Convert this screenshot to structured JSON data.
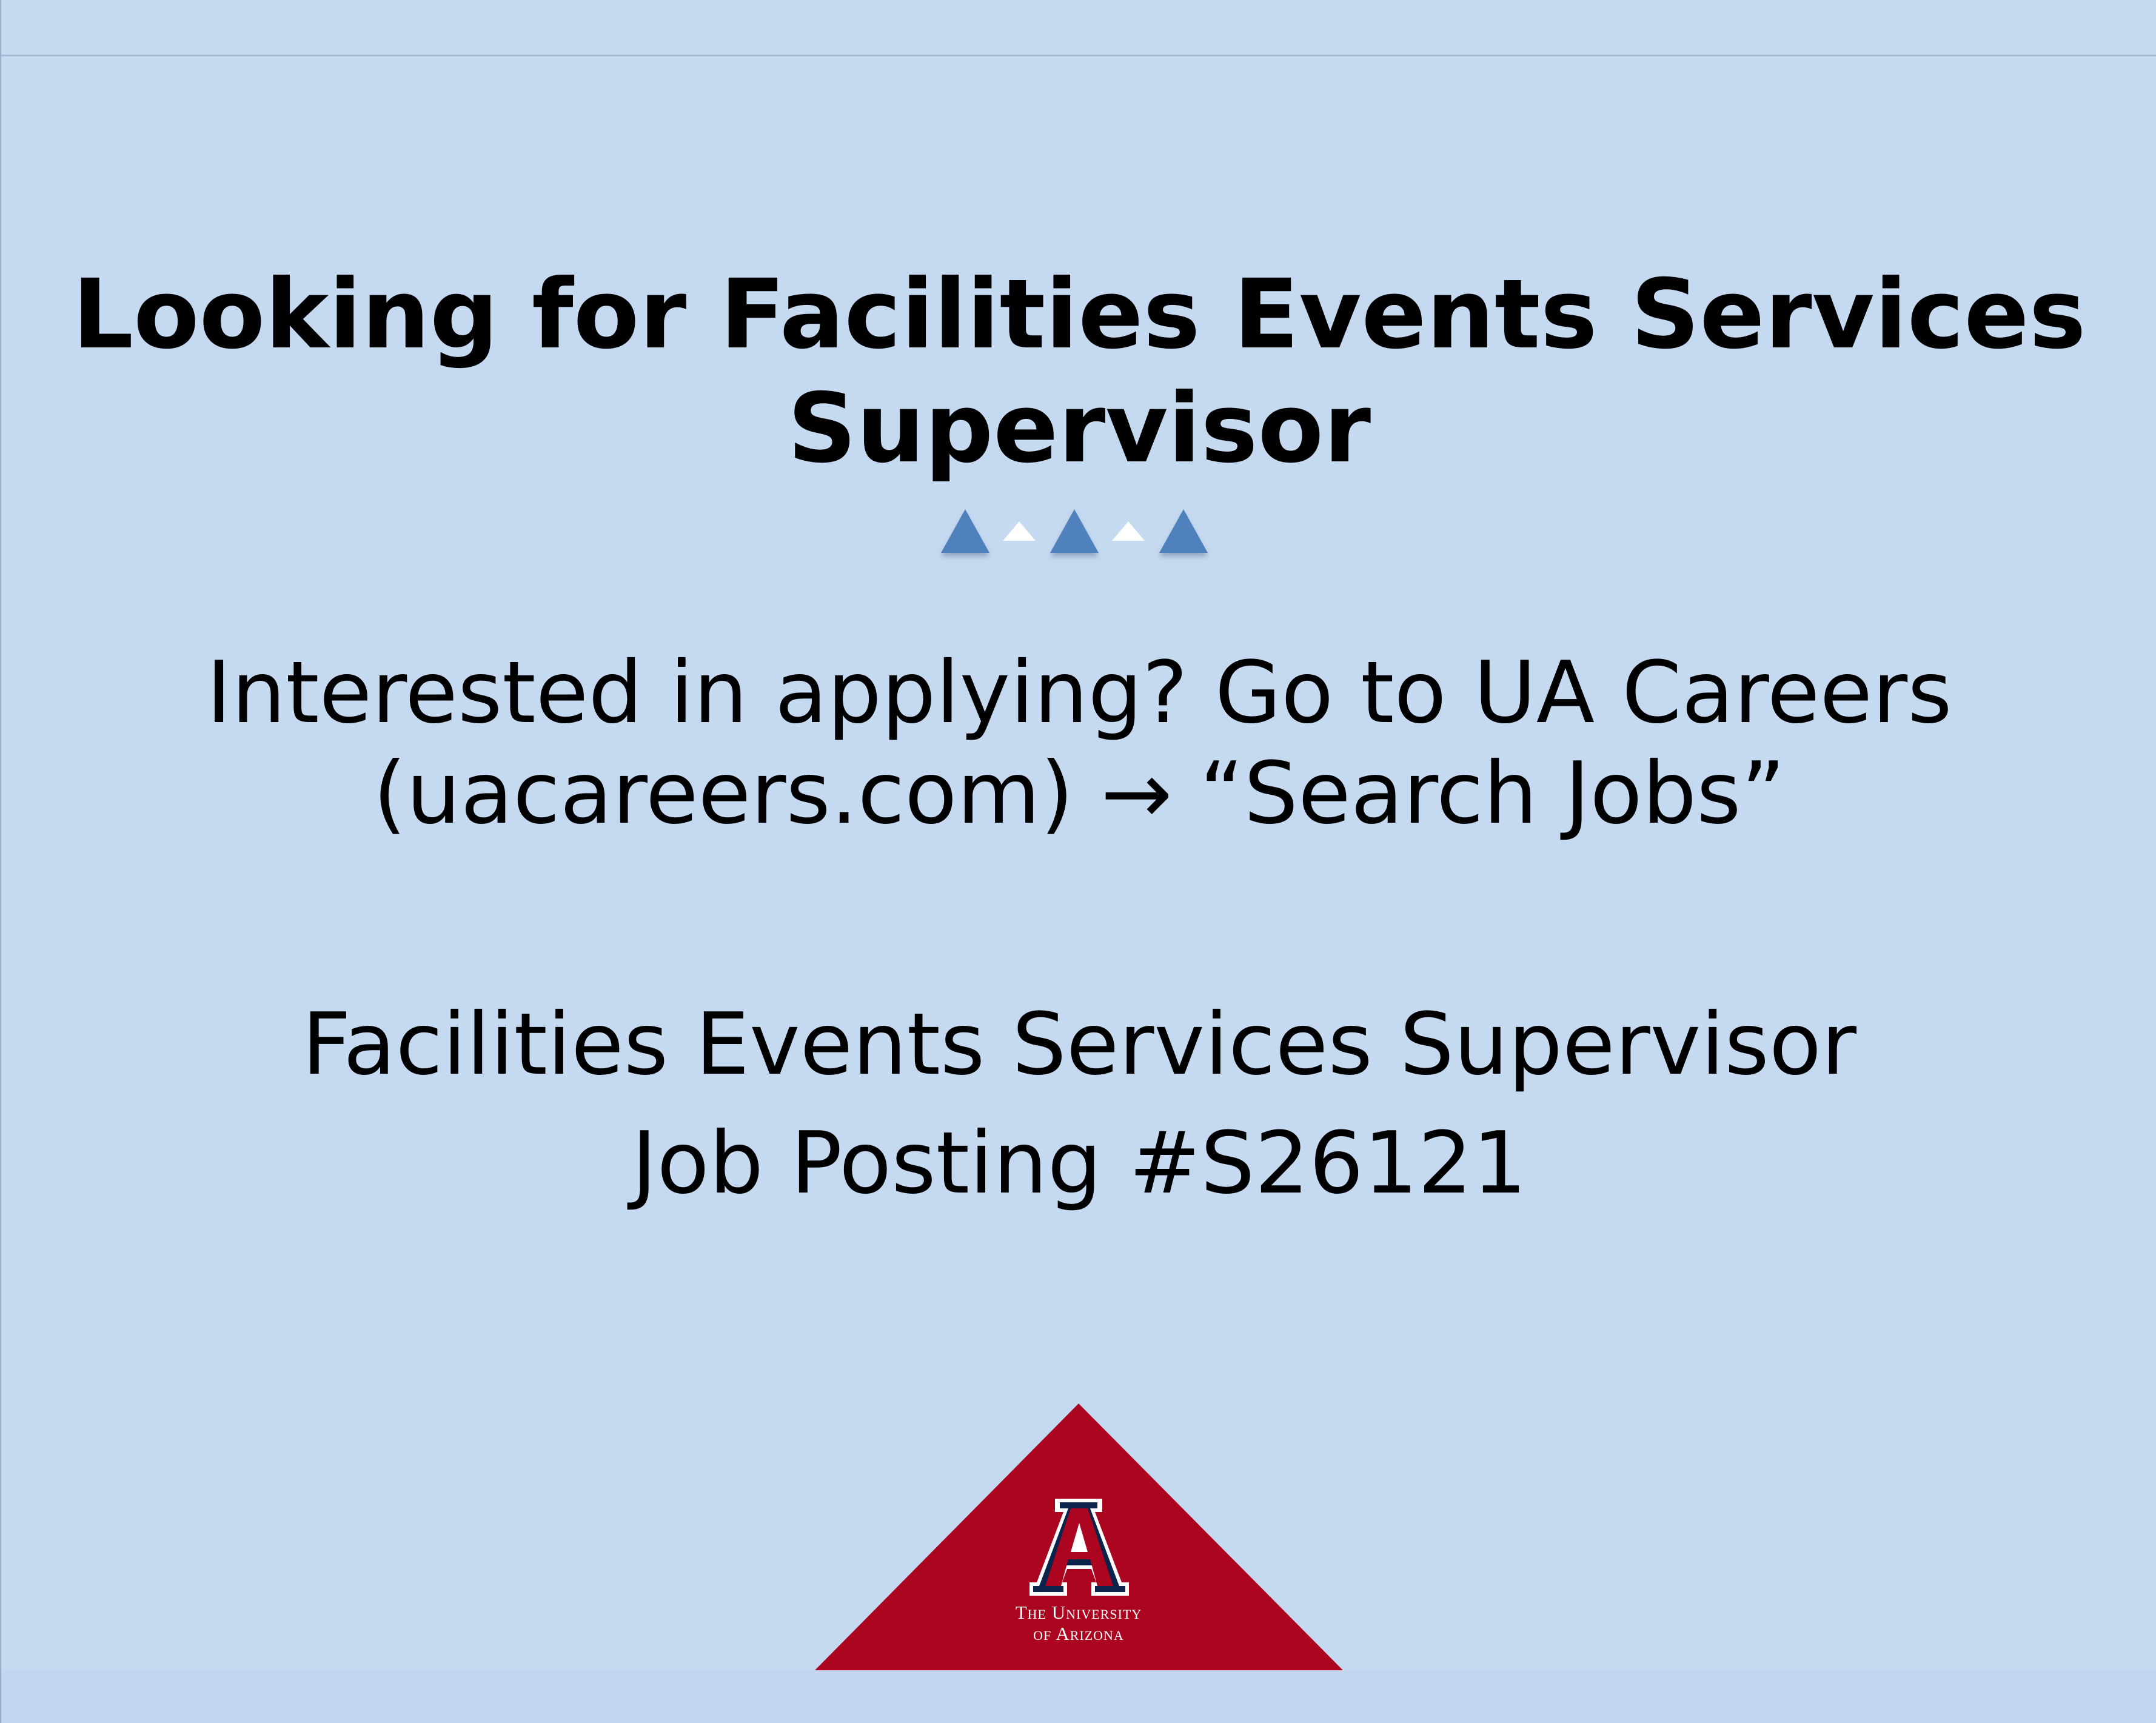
{
  "slide": {
    "title_line1": "Looking for Facilities Events Services",
    "title_line2": "Supervisor",
    "apply_line1": "Interested in applying? Go to UA Careers",
    "apply_line2": "(uacareers.com) → “Search Jobs”",
    "posting_title": "Facilities Events Services Supervisor",
    "posting_number": "Job Posting #S26121"
  },
  "logo": {
    "name": "university-of-arizona-logo",
    "wordmark_line1": "The University",
    "wordmark_line2": "of Arizona"
  },
  "colors": {
    "background": "#c5d9f1",
    "accent_blue": "#4f81bd",
    "logo_red": "#ab0520",
    "logo_navy": "#0c234b"
  }
}
